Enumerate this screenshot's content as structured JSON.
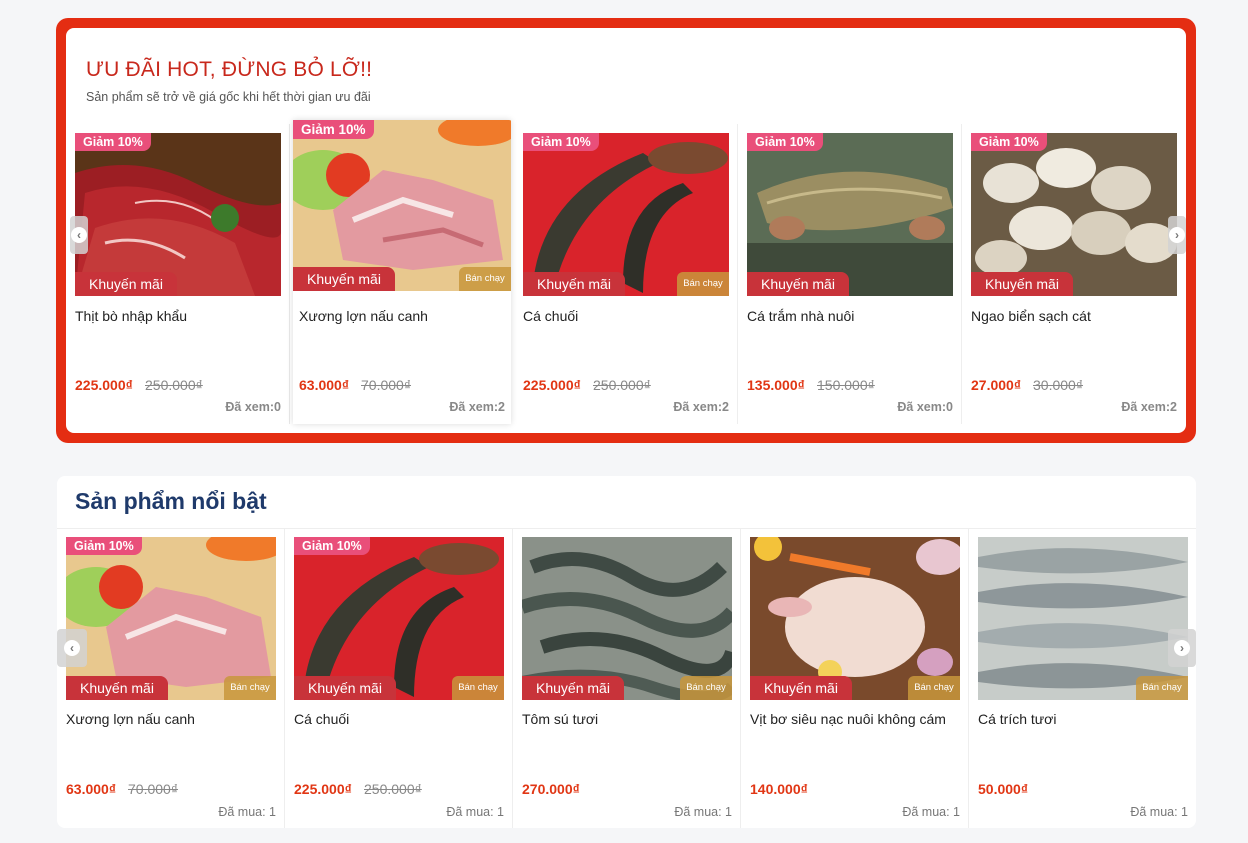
{
  "hot_deals": {
    "title": "ƯU ĐÃI HOT, ĐỪNG BỎ LỠ!!",
    "subtitle": "Sản phẩm sẽ trở về giá gốc khi hết thời gian ưu đãi",
    "products": [
      {
        "name": "Thịt bò nhập khẩu",
        "discount": "Giảm 10%",
        "promo": "Khuyến mãi",
        "price": "225.000₫",
        "old_price": "250.000₫",
        "views": "Đã xem:0",
        "image": "beef-image"
      },
      {
        "name": "Xương lợn nấu canh",
        "discount": "Giảm 10%",
        "promo": "Khuyến mãi",
        "hot": "Bán chạy",
        "price": "63.000₫",
        "old_price": "70.000₫",
        "views": "Đã xem:2",
        "image": "pork-bones-image"
      },
      {
        "name": "Cá chuối",
        "discount": "Giảm 10%",
        "promo": "Khuyến mãi",
        "hot": "Bán chạy",
        "price": "225.000₫",
        "old_price": "250.000₫",
        "views": "Đã xem:2",
        "image": "snakehead-fish-image"
      },
      {
        "name": "Cá trắm nhà nuôi",
        "discount": "Giảm 10%",
        "promo": "Khuyến mãi",
        "price": "135.000₫",
        "old_price": "150.000₫",
        "views": "Đã xem:0",
        "image": "grass-carp-image"
      },
      {
        "name": "Ngao biển sạch cát",
        "discount": "Giảm 10%",
        "promo": "Khuyến mãi",
        "price": "27.000₫",
        "old_price": "30.000₫",
        "views": "Đã xem:2",
        "image": "clams-image"
      }
    ]
  },
  "featured": {
    "title": "Sản phẩm nổi bật",
    "products": [
      {
        "name": "Xương lợn nấu canh",
        "discount": "Giảm 10%",
        "promo": "Khuyến mãi",
        "hot": "Bán chạy",
        "price": "63.000₫",
        "old_price": "70.000₫",
        "sold": "Đã mua: 1",
        "image": "pork-bones-image"
      },
      {
        "name": "Cá chuối",
        "discount": "Giảm 10%",
        "promo": "Khuyến mãi",
        "hot": "Bán chạy",
        "price": "225.000₫",
        "old_price": "250.000₫",
        "sold": "Đã mua: 1",
        "image": "snakehead-fish-image"
      },
      {
        "name": "Tôm sú tươi",
        "promo": "Khuyến mãi",
        "hot": "Bán chạy",
        "price": "270.000₫",
        "sold": "Đã mua: 1",
        "image": "shrimp-image"
      },
      {
        "name": "Vịt bơ siêu nạc nuôi không cám",
        "promo": "Khuyến mãi",
        "hot": "Bán chạy",
        "price": "140.000₫",
        "sold": "Đã mua: 1",
        "image": "duck-image"
      },
      {
        "name": "Cá trích tươi",
        "hot": "Bán chạy",
        "price": "50.000₫",
        "sold": "Đã mua: 1",
        "image": "herring-image"
      }
    ]
  },
  "colors": {
    "accent": "#e42d12",
    "price": "#e13614",
    "badge": "#e94f7a",
    "promo": "#c8333a",
    "heading": "#1f3a6b"
  }
}
